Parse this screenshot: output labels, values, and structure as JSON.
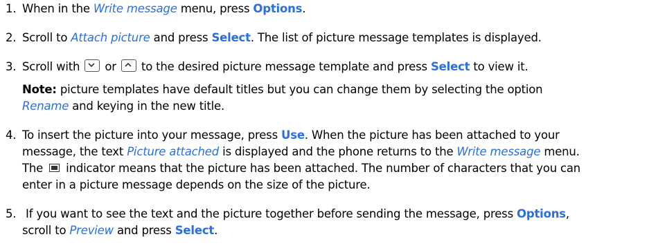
{
  "steps": [
    {
      "num": "1.",
      "p1": "When in the ",
      "i1": "Write message",
      "p2": " menu, press ",
      "b1": "Options",
      "p3": "."
    },
    {
      "num": "2.",
      "p1": "Scroll to ",
      "i1": "Attach picture",
      "p2": " and press ",
      "b1": "Select",
      "p3": ". The list of picture message templates is displayed."
    },
    {
      "num": "3.",
      "p1": "Scroll with ",
      "p2": " or ",
      "p3": " to the desired picture message template and press ",
      "b1": "Select",
      "p4": " to view it.",
      "note_label": "Note:",
      "note_p1": " picture templates have default titles but you can change them by selecting the option",
      "note_i1": "Rename",
      "note_p2": " and keying in the new title."
    },
    {
      "num": "4.",
      "p1": "To insert the picture into your message, press ",
      "b1": "Use",
      "p2": ". When the picture has been attached to your",
      "l2_p1": "message, the text ",
      "l2_i1": "Picture attached",
      "l2_p2": " is displayed and the phone returns to the ",
      "l2_i2": "Write message",
      "l2_p3": "  menu.",
      "l3_p1": "The ",
      "l3_p2": " indicator means that the picture has been attached. The number of characters that you can",
      "l4_p1": "enter in a picture message depends on the size of the picture."
    },
    {
      "num": "5.",
      "p1": " If you want to see the text and the picture together before sending the message, press ",
      "b1": "Options",
      "p2": ",",
      "l2_p1": "scroll to ",
      "l2_i1": "Preview",
      "l2_p2": " and press ",
      "l2_b1": "Select",
      "l2_p3": "."
    }
  ],
  "icons": {
    "scroll_down": "scroll-down-key-icon",
    "scroll_up": "scroll-up-key-icon",
    "picture_indicator": "picture-attached-indicator-icon"
  },
  "colors": {
    "accent": "#2a6fe0",
    "text": "#000000"
  }
}
